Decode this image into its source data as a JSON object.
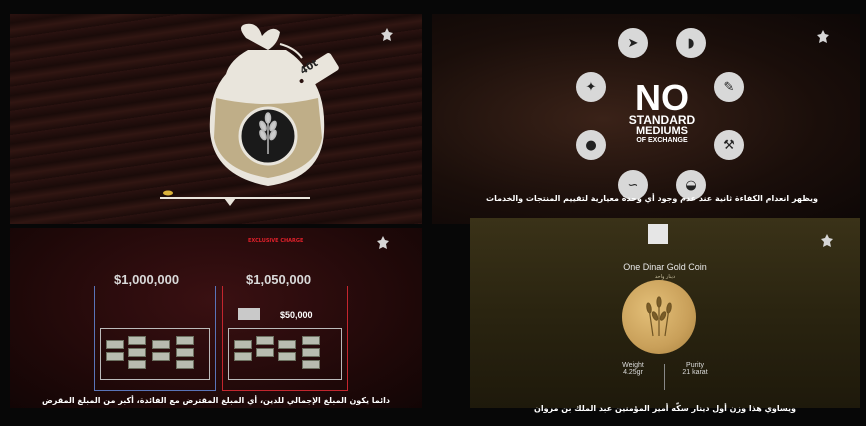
{
  "panels": {
    "top_left": {
      "tag_text": "40t",
      "logo_icon": "flag-emblem-icon"
    },
    "top_right": {
      "headline_big": "NO",
      "headline_line2": "STANDARD",
      "headline_line3": "MEDIUMS",
      "headline_line4": "OF EXCHANGE",
      "caption": "ويظهر انعدام الكفاءة ثانية عند عدم وجود أي وحدة معيارية لتقييم المنتجات والخدمات",
      "icons": [
        "arrowhead-icon",
        "watermelon-icon",
        "wheat-icon",
        "carrot-icon",
        "meat-icon",
        "axe-icon",
        "horn-icon",
        "bread-icon"
      ]
    },
    "bottom_left": {
      "left_amount": "$1,000,000",
      "right_amount": "$1,050,000",
      "chip_amount": "$50,000",
      "red_heading": "EXCLUSIVE CHARGE",
      "caption": "دائما يكون المبلغ الإجمالي للدين، أي المبلغ المقترض مع الفائدة، أكبر من المبلغ المقرض"
    },
    "bottom_right": {
      "coin_title": "One Dinar Gold Coin",
      "coin_subtitle": "دينار واحد",
      "weight_label": "Weight",
      "weight_value": "4.25gr",
      "purity_label": "Purity",
      "purity_value": "21 karat",
      "caption": "ويساوي هذا وزن أول دينار سكّه أمير المؤمنين عبد الملك بن مروان"
    }
  },
  "colors": {
    "frame": "#070707",
    "accent_red": "#e0202a",
    "gold": "#c9a05a"
  }
}
